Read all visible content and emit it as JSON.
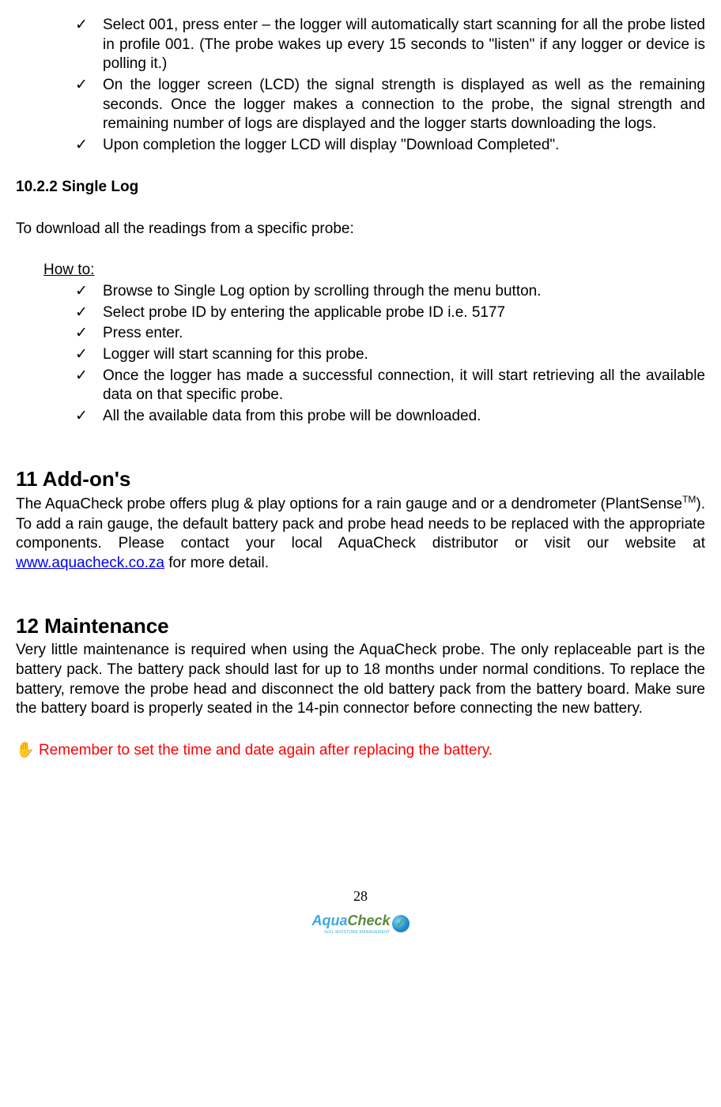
{
  "top_checklist": [
    "Select 001, press enter – the logger will automatically start scanning for all the probe listed in profile 001. (The probe wakes up every 15 seconds to \"listen\" if any logger or device is polling it.)",
    "On the logger screen (LCD) the signal strength is displayed as well as the remaining seconds. Once the logger makes a connection to the probe, the signal strength and remaining number of logs are displayed and the logger starts downloading the logs.",
    "Upon completion the logger LCD will display \"Download Completed\"."
  ],
  "subsection_1022": {
    "heading": "10.2.2 Single Log",
    "intro": "To download all the readings from a specific probe:",
    "howto_label": "How to:",
    "items": [
      "Browse to Single Log option by scrolling through the menu button.",
      "Select probe ID by entering the applicable probe ID i.e. 5177",
      "Press enter.",
      "Logger will start scanning for this probe.",
      "Once the logger has made a successful connection, it will start retrieving all the available data on that specific probe.",
      "All the available data from this probe will be downloaded."
    ]
  },
  "section_11": {
    "heading": "11 Add-on's",
    "body_pre": "The AquaCheck probe offers plug & play options for a rain gauge and or a dendrometer (PlantSense",
    "tm": "TM",
    "body_mid": "). To add a rain gauge, the default battery pack and probe head needs to be replaced with the appropriate components. Please contact your local AquaCheck distributor or visit our website at ",
    "link_text": "www.aquacheck.co.za",
    "body_post": " for more detail."
  },
  "section_12": {
    "heading": "12 Maintenance",
    "body": "Very little maintenance is required when using the AquaCheck probe. The only replaceable part is the battery pack. The battery pack should last for up to 18 months under normal conditions. To replace the battery, remove the probe head and disconnect the old battery pack from the battery board. Make sure the battery board is properly seated in the 14-pin connector before connecting the new battery.",
    "warning_icon": "✋",
    "warning_text": " Remember to set the time and date again after replacing the battery."
  },
  "footer": {
    "page_number": "28",
    "logo_aqua": "Aqua",
    "logo_check": "Check",
    "logo_sub": "SOIL MOISTURE MANAGEMENT"
  }
}
